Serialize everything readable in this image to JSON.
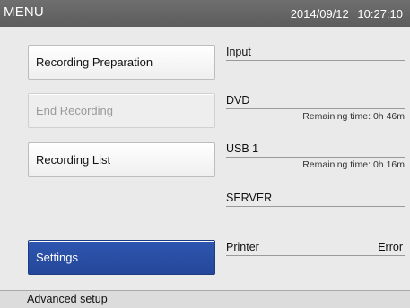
{
  "titlebar": {
    "title": "MENU",
    "date": "2014/09/12",
    "time": "10:27:10"
  },
  "buttons": {
    "recording_preparation": "Recording Preparation",
    "end_recording": "End Recording",
    "recording_list": "Recording List",
    "settings": "Settings"
  },
  "status": {
    "input": {
      "label": "Input"
    },
    "dvd": {
      "label": "DVD",
      "remaining": "Remaining time: 0h 46m"
    },
    "usb1": {
      "label": "USB 1",
      "remaining": "Remaining time: 0h 16m"
    },
    "server": {
      "label": "SERVER"
    },
    "printer": {
      "label": "Printer",
      "state": "Error"
    }
  },
  "footer": {
    "hint": "Advanced setup"
  },
  "colors": {
    "titlebar": "#636363",
    "selected_button": "#2a4fa6",
    "background": "#eaeaea"
  }
}
